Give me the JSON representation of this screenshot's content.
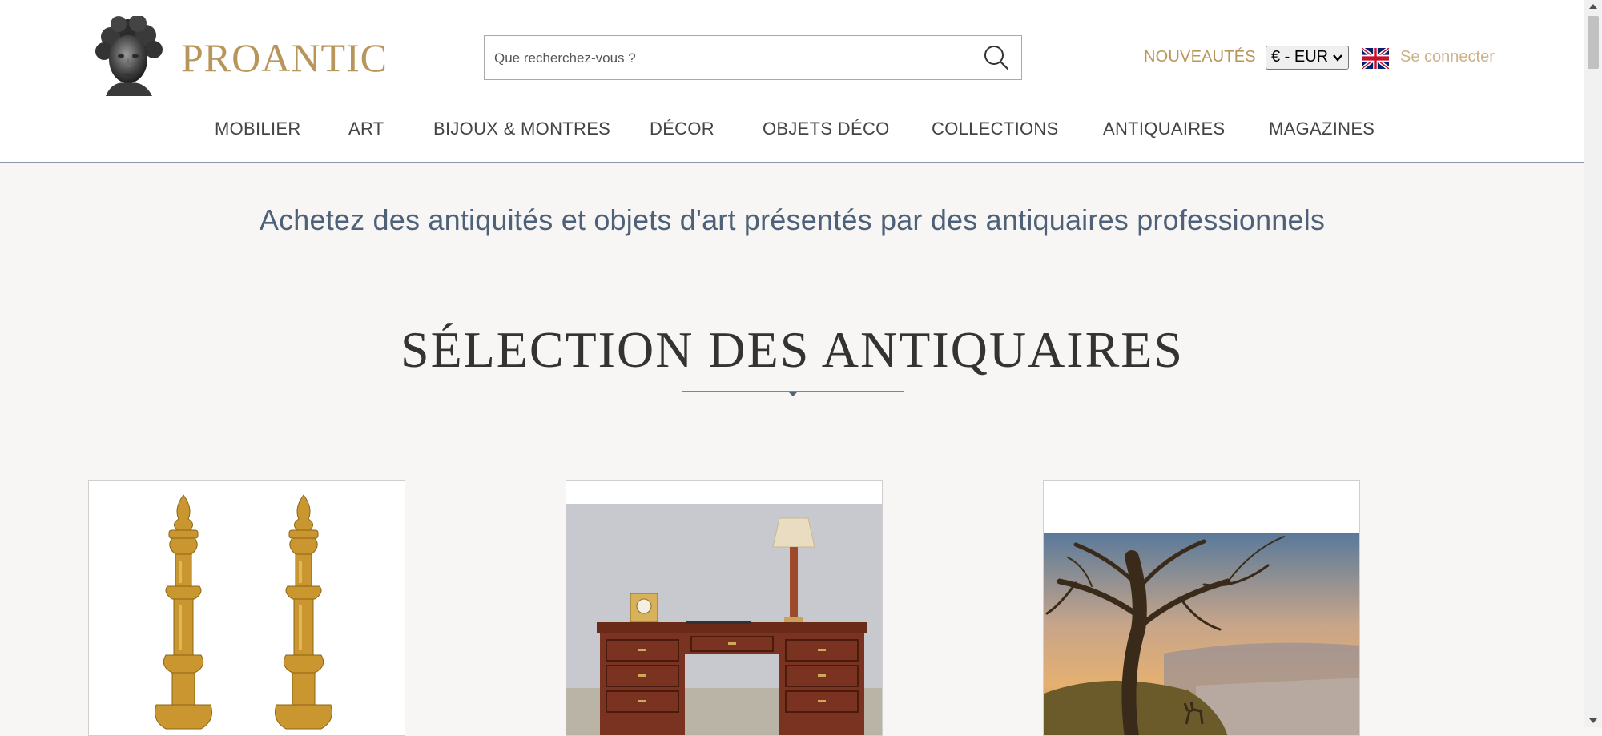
{
  "brand": {
    "name": "PROANTIC",
    "accent": "#b8955a"
  },
  "search": {
    "placeholder": "Que recherchez-vous ?"
  },
  "header": {
    "new_label": "NOUVEAUTÉS",
    "currency_value": "€ - EUR",
    "language_flag": "uk-flag-icon",
    "login_label": "Se connecter"
  },
  "nav": {
    "items": [
      {
        "label": "MOBILIER"
      },
      {
        "label": "ART"
      },
      {
        "label": "BIJOUX & MONTRES"
      },
      {
        "label": "DÉCOR"
      },
      {
        "label": "OBJETS DÉCO"
      },
      {
        "label": "COLLECTIONS"
      },
      {
        "label": "ANTIQUAIRES"
      },
      {
        "label": "MAGAZINES"
      }
    ]
  },
  "main": {
    "tagline": "Achetez des antiquités et objets d'art présentés par des antiquaires professionnels",
    "section_title": "SÉLECTION DES ANTIQUAIRES",
    "cards": [
      {
        "image": "gilt-bronze-candlesticks"
      },
      {
        "image": "mahogany-desk-with-lamp"
      },
      {
        "image": "landscape-painting-tree-deer"
      }
    ]
  }
}
